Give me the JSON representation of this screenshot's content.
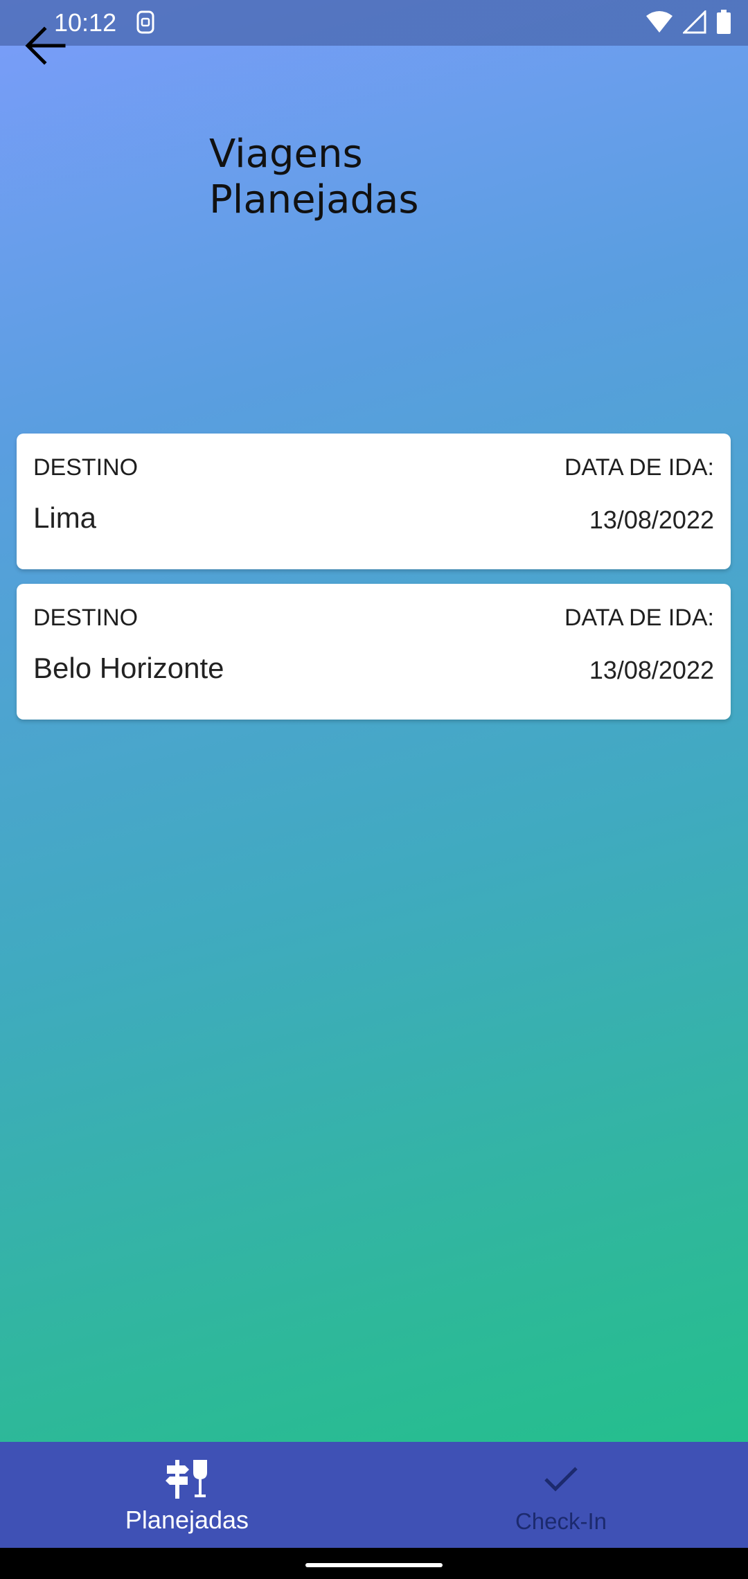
{
  "status_bar": {
    "time": "10:12"
  },
  "page": {
    "title_line1": "Viagens",
    "title_line2": "Planejadas"
  },
  "trips": [
    {
      "destino_label": "DESTINO",
      "data_label": "DATA DE IDA:",
      "destino": "Lima",
      "data": "13/08/2022"
    },
    {
      "destino_label": "DESTINO",
      "data_label": "DATA DE IDA:",
      "destino": "Belo Horizonte",
      "data": "13/08/2022"
    }
  ],
  "nav": {
    "items": [
      {
        "label": "Planejadas",
        "icon": "directions-signpost-icon",
        "active": true
      },
      {
        "label": "Check-In",
        "icon": "check-icon",
        "active": false
      }
    ]
  },
  "colors": {
    "nav_bg": "#3f51b5",
    "gradient_top": "#7b9dfa",
    "gradient_bottom": "#1ec384"
  }
}
